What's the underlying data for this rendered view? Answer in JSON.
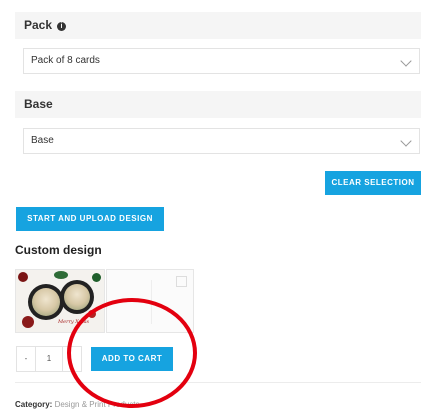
{
  "pack": {
    "label": "Pack",
    "info_icon": "info-icon",
    "selected": "Pack of 8 cards"
  },
  "base": {
    "label": "Base",
    "selected": "Base"
  },
  "clear_selection_label": "CLEAR SELECTION",
  "upload_button_label": "START AND UPLOAD DESIGN",
  "custom_design": {
    "heading": "Custom design",
    "thumb_text": "Merry Xmas"
  },
  "cart": {
    "minus": "-",
    "quantity": "1",
    "add_label": "ADD TO CART"
  },
  "category": {
    "label": "Category:",
    "value": "Design & Print Products"
  },
  "colors": {
    "accent": "#16a3e0",
    "annotation": "#e3000f"
  }
}
